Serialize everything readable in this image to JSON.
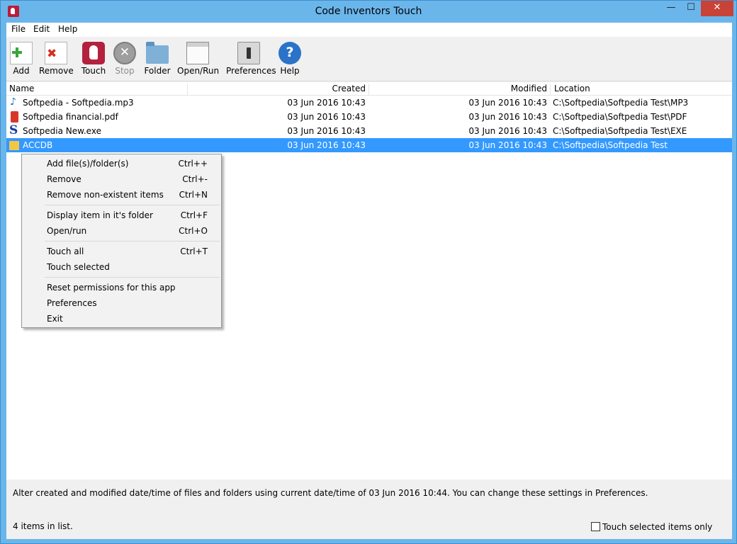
{
  "window": {
    "title": "Code Inventors Touch",
    "min": "—",
    "max": "☐",
    "close": "✕"
  },
  "menu": [
    "File",
    "Edit",
    "Help"
  ],
  "toolbar": {
    "add": "Add",
    "remove": "Remove",
    "touch": "Touch",
    "stop": "Stop",
    "folder": "Folder",
    "open_run": "Open/Run",
    "preferences": "Preferences",
    "help": "Help"
  },
  "columns": {
    "name": "Name",
    "created": "Created",
    "modified": "Modified",
    "location": "Location"
  },
  "files": [
    {
      "name": "Softpedia - Softpedia.mp3",
      "created": "03 Jun 2016  10:43",
      "modified": "03 Jun 2016  10:43",
      "location": "C:\\Softpedia\\Softpedia Test\\MP3",
      "icon": "mp3-file-icon"
    },
    {
      "name": "Softpedia financial.pdf",
      "created": "03 Jun 2016  10:43",
      "modified": "03 Jun 2016  10:43",
      "location": "C:\\Softpedia\\Softpedia Test\\PDF",
      "icon": "pdf-file-icon"
    },
    {
      "name": "Softpedia New.exe",
      "created": "03 Jun 2016  10:43",
      "modified": "03 Jun 2016  10:43",
      "location": "C:\\Softpedia\\Softpedia Test\\EXE",
      "icon": "exe-file-icon"
    },
    {
      "name": "ACCDB",
      "created": "03 Jun 2016  10:43",
      "modified": "03 Jun 2016  10:43",
      "location": "C:\\Softpedia\\Softpedia Test",
      "icon": "folder-icon",
      "selected": true
    }
  ],
  "context_menu": {
    "add": {
      "label": "Add file(s)/folder(s)",
      "shortcut": "Ctrl++"
    },
    "remove": {
      "label": "Remove",
      "shortcut": "Ctrl+-"
    },
    "remove_nonexistent": {
      "label": "Remove non-existent items",
      "shortcut": "Ctrl+N"
    },
    "display_in_folder": {
      "label": "Display item in it's folder",
      "shortcut": "Ctrl+F"
    },
    "open_run": {
      "label": "Open/run",
      "shortcut": "Ctrl+O"
    },
    "touch_all": {
      "label": "Touch all",
      "shortcut": "Ctrl+T"
    },
    "touch_selected": {
      "label": "Touch selected"
    },
    "reset_permissions": {
      "label": "Reset permissions for this app"
    },
    "preferences": {
      "label": "Preferences"
    },
    "exit": {
      "label": "Exit"
    }
  },
  "status": {
    "description": "Alter created and modified date/time of files and folders using current date/time of 03 Jun 2016  10:44. You can change these settings in Preferences.",
    "count": "4 items in list.",
    "touch_selected_only": "Touch selected items only",
    "touch_selected_only_checked": false
  },
  "colors": {
    "selection": "#3399ff",
    "titlebar": "#6ab6eb",
    "close": "#c94238"
  }
}
